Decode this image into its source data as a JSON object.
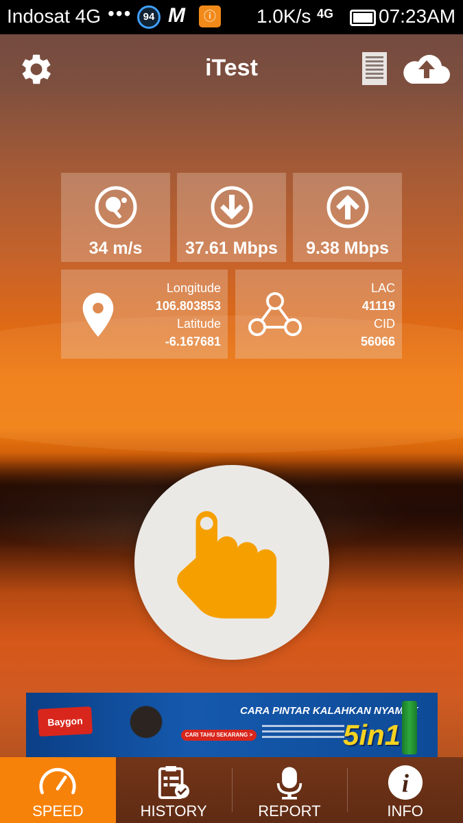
{
  "status_bar": {
    "carrier": "Indosat 4G",
    "dots": "•••",
    "badge": "94",
    "net_speed": "1.0K/s",
    "signal": "4G",
    "time": "07:23AM"
  },
  "app": {
    "title": "iTest"
  },
  "stats": {
    "ping": "34 m/s",
    "download": "37.61 Mbps",
    "upload": "9.38 Mbps"
  },
  "location": {
    "longitude_label": "Longitude",
    "longitude": "106.803853",
    "latitude_label": "Latitude",
    "latitude": "-6.167681"
  },
  "cell": {
    "lac_label": "LAC",
    "lac": "41119",
    "cid_label": "CID",
    "cid": "56066"
  },
  "ad": {
    "brand": "Baygon",
    "headline": "CARA PINTAR KALAHKAN NYAMUK",
    "badge": "5in1",
    "tagline": "CARI TAHU SEKARANG >"
  },
  "nav": {
    "speed": "SPEED",
    "history": "HISTORY",
    "report": "REPORT",
    "info": "INFO"
  },
  "colors": {
    "accent": "#f7820a",
    "hand": "#f5a000"
  }
}
